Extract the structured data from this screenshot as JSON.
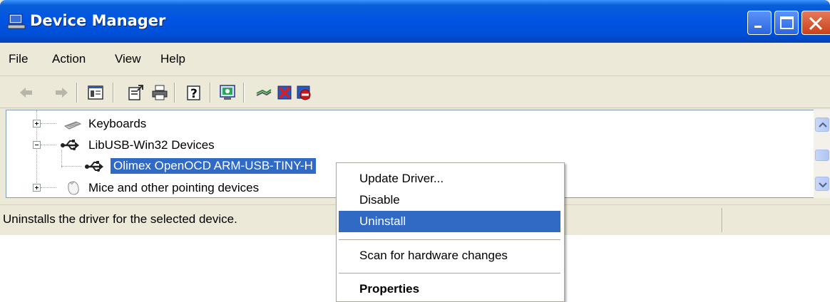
{
  "window": {
    "title": "Device Manager",
    "icon": "computer-icon",
    "controls": [
      "minimize-icon",
      "maximize-icon",
      "close-icon"
    ]
  },
  "menu": {
    "items": [
      {
        "label": "File"
      },
      {
        "label": "Action"
      },
      {
        "label": "View"
      },
      {
        "label": "Help"
      }
    ]
  },
  "toolbar": {
    "buttons": [
      {
        "icon": "back-arrow-icon"
      },
      {
        "icon": "forward-arrow-icon"
      },
      {
        "icon": "show-hide-console-tree-icon"
      },
      {
        "icon": "properties-icon"
      },
      {
        "icon": "print-icon"
      },
      {
        "icon": "help-icon"
      },
      {
        "icon": "scan-hardware-icon"
      },
      {
        "icon": "update-driver-icon"
      },
      {
        "icon": "uninstall-icon"
      },
      {
        "icon": "disable-icon"
      }
    ]
  },
  "tree": {
    "items": [
      {
        "label": "Keyboards",
        "icon": "keyboard-icon",
        "expander": "+"
      },
      {
        "label": "LibUSB-Win32 Devices",
        "icon": "usb-icon",
        "expander": "-"
      },
      {
        "label": "Olimex OpenOCD ARM-USB-TINY-H",
        "icon": "usb-icon",
        "selected": true
      },
      {
        "label": "Mice and other pointing devices",
        "icon": "mouse-icon",
        "expander": "+"
      }
    ]
  },
  "status": {
    "text": "Uninstalls the driver for the selected device."
  },
  "context_menu": {
    "items": [
      {
        "label": "Update Driver..."
      },
      {
        "label": "Disable"
      },
      {
        "label": "Uninstall",
        "highlighted": true
      },
      {
        "label": "Scan for hardware changes"
      },
      {
        "label": "Properties",
        "bold": true
      }
    ]
  },
  "colors": {
    "titlebar": "#0054e3",
    "selection": "#316ac5",
    "chrome": "#ece9d8"
  }
}
